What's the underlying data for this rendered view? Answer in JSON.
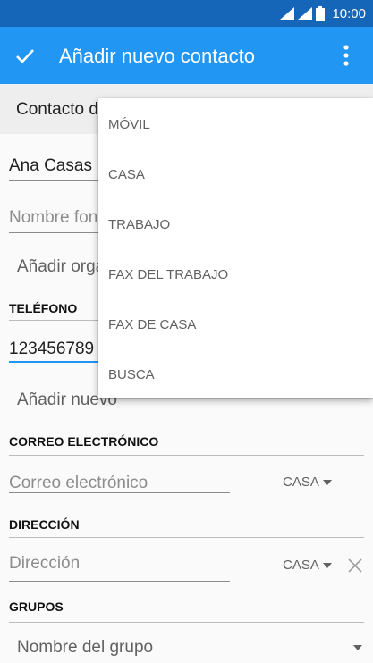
{
  "status_bar": {
    "time": "10:00"
  },
  "app_bar": {
    "title": "Añadir nuevo contacto"
  },
  "account": {
    "label": "Contacto del teléfono"
  },
  "name_fields": {
    "name_value": "Ana Casas",
    "phonetic_placeholder": "Nombre fonético"
  },
  "organization": {
    "add_label": "Añadir organización"
  },
  "phone": {
    "header": "TELÉFONO",
    "value": "123456789",
    "add_new_label": "Añadir nuevo"
  },
  "email": {
    "header": "CORREO ELECTRÓNICO",
    "placeholder": "Correo electrónico",
    "type": "CASA"
  },
  "address": {
    "header": "DIRECCIÓN",
    "placeholder": "Dirección",
    "type": "CASA"
  },
  "groups": {
    "header": "GRUPOS",
    "placeholder": "Nombre del grupo"
  },
  "type_menu": {
    "items": [
      {
        "label": "MÓVIL"
      },
      {
        "label": "CASA"
      },
      {
        "label": "TRABAJO"
      },
      {
        "label": "FAX DEL TRABAJO"
      },
      {
        "label": "FAX DE CASA"
      },
      {
        "label": "BUSCA"
      }
    ]
  },
  "colors": {
    "status_bar": "#1565b8",
    "app_bar": "#2196f3",
    "accent": "#2196f3"
  }
}
